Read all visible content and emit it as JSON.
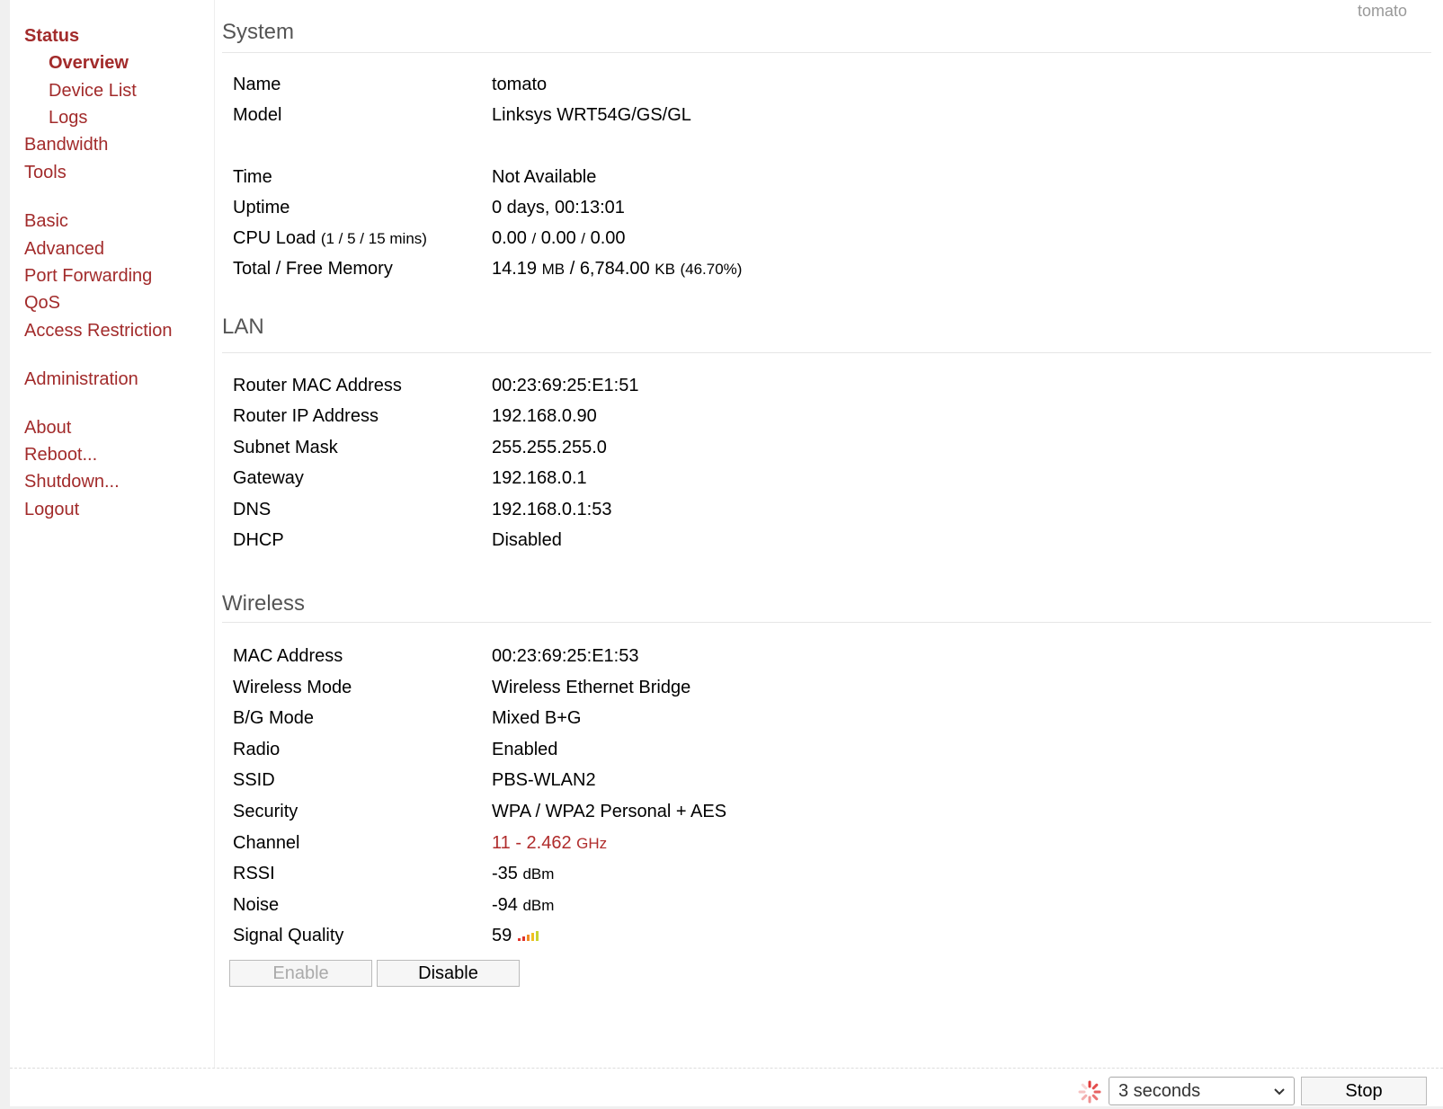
{
  "header": {
    "router_name": "tomato"
  },
  "sidebar": {
    "status": "Status",
    "overview": "Overview",
    "device_list": "Device List",
    "logs": "Logs",
    "bandwidth": "Bandwidth",
    "tools": "Tools",
    "basic": "Basic",
    "advanced": "Advanced",
    "port_forwarding": "Port Forwarding",
    "qos": "QoS",
    "access_restriction": "Access Restriction",
    "administration": "Administration",
    "about": "About",
    "reboot": "Reboot...",
    "shutdown": "Shutdown...",
    "logout": "Logout"
  },
  "system": {
    "title": "System",
    "name_label": "Name",
    "name_value": "tomato",
    "model_label": "Model",
    "model_value": "Linksys WRT54G/GS/GL",
    "time_label": "Time",
    "time_value": "Not Available",
    "uptime_label": "Uptime",
    "uptime_value": "0 days, 00:13:01",
    "cpu_label": "CPU Load",
    "cpu_note": "(1 / 5 / 15 mins)",
    "cpu_1": "0.00",
    "cpu_sep1": "/",
    "cpu_5": "0.00",
    "cpu_sep2": "/",
    "cpu_15": "0.00",
    "memory_label": "Total / Free Memory",
    "mem_total": "14.19",
    "mem_total_unit": "MB",
    "mem_sep": "/",
    "mem_free": "6,784.00",
    "mem_free_unit": "KB",
    "mem_pct": "(46.70%)"
  },
  "lan": {
    "title": "LAN",
    "mac_label": "Router MAC Address",
    "mac_value": "00:23:69:25:E1:51",
    "ip_label": "Router IP Address",
    "ip_value": "192.168.0.90",
    "mask_label": "Subnet Mask",
    "mask_value": "255.255.255.0",
    "gateway_label": "Gateway",
    "gateway_value": "192.168.0.1",
    "dns_label": "DNS",
    "dns_value": "192.168.0.1:53",
    "dhcp_label": "DHCP",
    "dhcp_value": "Disabled"
  },
  "wireless": {
    "title": "Wireless",
    "mac_label": "MAC Address",
    "mac_value": "00:23:69:25:E1:53",
    "mode_label": "Wireless Mode",
    "mode_value": "Wireless Ethernet Bridge",
    "bg_label": "B/G Mode",
    "bg_value": "Mixed B+G",
    "radio_label": "Radio",
    "radio_value": "Enabled",
    "ssid_label": "SSID",
    "ssid_value": "PBS-WLAN2",
    "security_label": "Security",
    "security_value": "WPA / WPA2 Personal + AES",
    "channel_label": "Channel",
    "channel_value": "11 - 2.462",
    "channel_unit": "GHz",
    "rssi_label": "RSSI",
    "rssi_value": "-35",
    "rssi_unit": "dBm",
    "noise_label": "Noise",
    "noise_value": "-94",
    "noise_unit": "dBm",
    "quality_label": "Signal Quality",
    "quality_value": "59",
    "enable_button": "Enable",
    "disable_button": "Disable"
  },
  "footer": {
    "refresh_interval": "3 seconds",
    "stop_button": "Stop"
  },
  "colors": {
    "accent": "#a22b2b",
    "channel": "#b02c2c"
  },
  "icons": {
    "spinner": "loading-spinner-icon",
    "dropdown": "chevron-down-icon",
    "signal": "signal-bars-icon"
  }
}
